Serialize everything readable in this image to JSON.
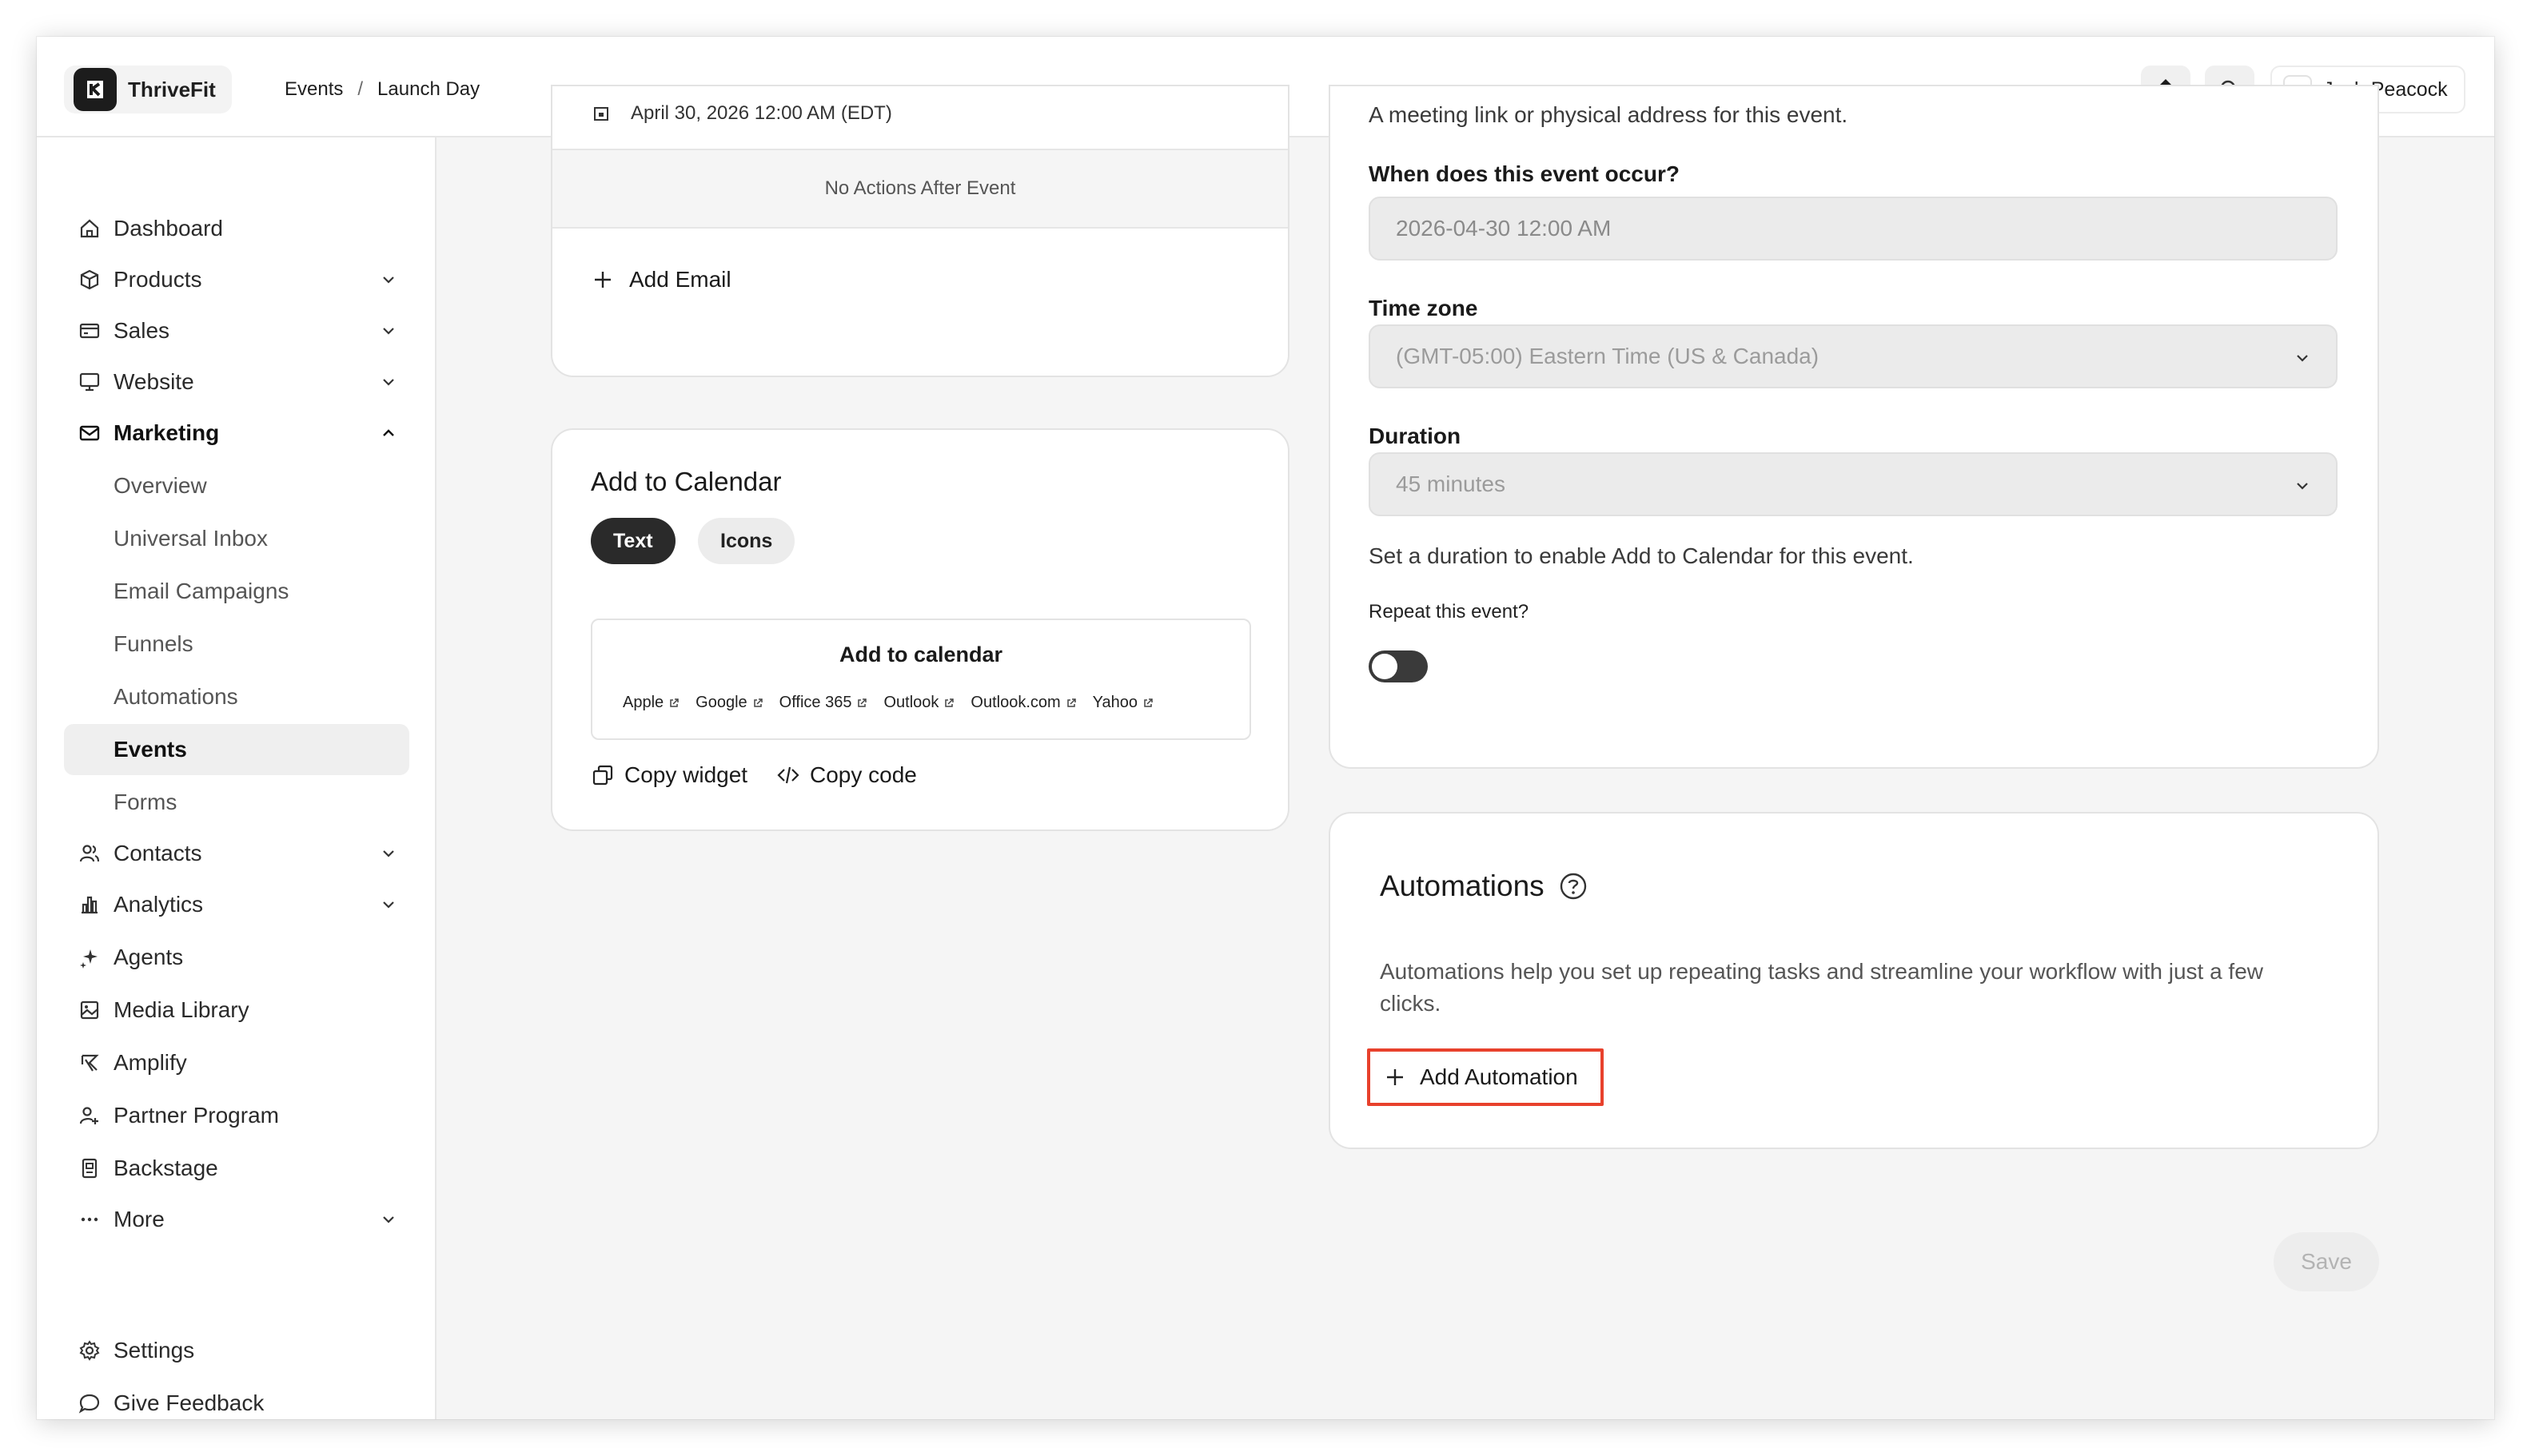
{
  "header": {
    "brand": "ThriveFit",
    "breadcrumb": [
      "Events",
      "Launch Day"
    ],
    "breadcrumb_sep": "/",
    "user_name": "Josh Peacock"
  },
  "sidebar": {
    "items": [
      {
        "label": "Dashboard",
        "icon": "home-icon"
      },
      {
        "label": "Products",
        "icon": "box-icon",
        "chevron": "down"
      },
      {
        "label": "Sales",
        "icon": "credit-card-icon",
        "chevron": "down"
      },
      {
        "label": "Website",
        "icon": "monitor-icon",
        "chevron": "down"
      },
      {
        "label": "Marketing",
        "icon": "mail-icon",
        "chevron": "up"
      },
      {
        "label": "Overview"
      },
      {
        "label": "Universal Inbox"
      },
      {
        "label": "Email Campaigns"
      },
      {
        "label": "Funnels"
      },
      {
        "label": "Automations"
      },
      {
        "label": "Events"
      },
      {
        "label": "Forms"
      },
      {
        "label": "Contacts",
        "icon": "users-icon",
        "chevron": "down"
      },
      {
        "label": "Analytics",
        "icon": "bar-chart-icon",
        "chevron": "down"
      },
      {
        "label": "Agents",
        "icon": "sparkle-icon"
      },
      {
        "label": "Media Library",
        "icon": "image-icon"
      },
      {
        "label": "Amplify",
        "icon": "megaphone-icon"
      },
      {
        "label": "Partner Program",
        "icon": "user-plus-icon"
      },
      {
        "label": "Backstage",
        "icon": "badge-icon"
      },
      {
        "label": "More",
        "icon": "dots-icon",
        "chevron": "down"
      }
    ],
    "settings": "Settings",
    "feedback": "Give Feedback"
  },
  "left_col": {
    "event_date": "April 30, 2026 12:00 AM (EDT)",
    "no_actions": "No Actions After Event",
    "add_email": "Add Email",
    "calendar": {
      "title": "Add to Calendar",
      "tabs": [
        "Text",
        "Icons"
      ],
      "active_tab": "Text",
      "widget_title": "Add to calendar",
      "providers": [
        "Apple",
        "Google",
        "Office 365",
        "Outlook",
        "Outlook.com",
        "Yahoo"
      ],
      "copy_widget": "Copy widget",
      "copy_code": "Copy code"
    }
  },
  "right_col": {
    "location_help": "A meeting link or physical address for this event.",
    "when_label": "When does this event occur?",
    "when_value": "2026-04-30 12:00 AM",
    "tz_label": "Time zone",
    "tz_value": "(GMT-05:00) Eastern Time (US & Canada)",
    "duration_label": "Duration",
    "duration_value": "45 minutes",
    "duration_help": "Set a duration to enable Add to Calendar for this event.",
    "repeat_label": "Repeat this event?",
    "repeat_on": false,
    "automations": {
      "title": "Automations",
      "desc_line1": "Automations help you set up repeating tasks and streamline your workflow with just a few",
      "desc_line2": "clicks.",
      "add_button": "Add Automation"
    },
    "save": "Save"
  },
  "colors": {
    "highlight": "#e8412c",
    "dark": "#1c1c1c"
  }
}
